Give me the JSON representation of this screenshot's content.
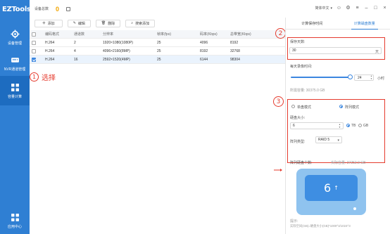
{
  "app": {
    "name": "EZTools"
  },
  "sidebar": {
    "items": [
      {
        "label": "设备管理",
        "icon": "gear-icon"
      },
      {
        "label": "NVR通道管理",
        "icon": "nvr-icon"
      },
      {
        "label": "容量计算",
        "icon": "capacity-icon"
      },
      {
        "label": "应用中心",
        "icon": "apps-icon"
      }
    ]
  },
  "topbar": {
    "device_total_label": "设备总数",
    "device_total": "0",
    "language": "简体中文"
  },
  "toolbar": {
    "add": "添加",
    "edit": "编辑",
    "delete": "删除",
    "search_add": "搜索添加"
  },
  "table": {
    "headers": [
      "编码格式",
      "通道数",
      "分辨率",
      "帧率(fps)",
      "码率(Kbps)",
      "总带宽(Kbps)"
    ],
    "rows": [
      {
        "checked": false,
        "cells": [
          "H.264",
          "2",
          "1920×1080(1080P)",
          "25",
          "4096",
          "8192"
        ]
      },
      {
        "checked": false,
        "cells": [
          "H.264",
          "4",
          "4096×2160(8MP)",
          "25",
          "8192",
          "32768"
        ]
      },
      {
        "checked": true,
        "cells": [
          "H.264",
          "16",
          "2592×1520(4MP)",
          "25",
          "6144",
          "98304"
        ]
      }
    ]
  },
  "annotations": {
    "step1_num": "1",
    "step1_text": "选择",
    "step2_num": "2",
    "step3_num": "3"
  },
  "panel": {
    "tabs": [
      "计算保存时间",
      "计算磁盘数量"
    ],
    "active_tab": 1,
    "save_days_label": "保存天数:",
    "save_days_value": "30",
    "save_days_unit": "天",
    "record_hours_label": "每天录像时间:",
    "record_hours_value": "24",
    "record_hours_unit": "小时",
    "record_hours_slider_fraction": 1.0,
    "total_capacity_label": "所需容量: 30375.0 GB",
    "mode_single": "单盘模式",
    "mode_array": "阵列模式",
    "mode_selected": "array",
    "disk_size_label": "硬盘大小:",
    "disk_size_value": "6",
    "unit_tb": "TB",
    "unit_gb": "GB",
    "unit_selected": "TB",
    "raid_label": "阵列类型:",
    "raid_value": "RAID 5",
    "disk_count_label": "阵列硬盘个数:",
    "actual_capacity_label": "实际容量: 37252.9 GB",
    "disk_count": "6",
    "tip_title": "提示:",
    "tip_text": "实际空间(GB)=硬盘大小(GB)*1000^3/1024^3"
  },
  "colors": {
    "sidebar": "#2f7fd3",
    "accent": "#3b86df",
    "annotation_red": "#e53b2e",
    "disk_light": "#8fc3ef",
    "disk_dark": "#3e8ee2"
  }
}
